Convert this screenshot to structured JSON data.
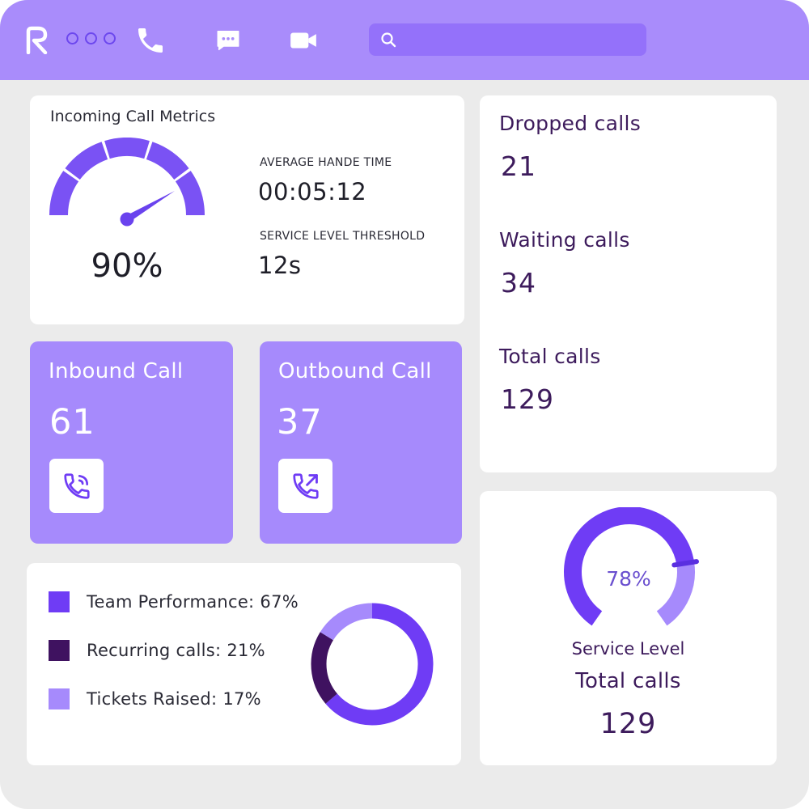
{
  "header": {
    "logo_letter": "R",
    "search_placeholder": "",
    "icons": [
      "logo-icon",
      "more-dots-icon",
      "phone-icon",
      "chat-icon",
      "video-icon",
      "search-icon"
    ]
  },
  "incoming_metrics": {
    "title": "Incoming Call Metrics",
    "gauge_value": "90%",
    "gauge_level": 0.9,
    "avg_handle_label": "AVERAGE HANDE TIME",
    "avg_handle_value": "00:05:12",
    "sla_threshold_label": "SERVICE LEVEL THRESHOLD",
    "sla_threshold_value": "12s"
  },
  "call_totals": {
    "dropped_label": "Dropped calls",
    "dropped_value": "21",
    "waiting_label": "Waiting calls",
    "waiting_value": "34",
    "total_label": "Total calls",
    "total_value": "129"
  },
  "inbound": {
    "title": "Inbound Call",
    "value": "61",
    "icon": "incoming-call-icon"
  },
  "outbound": {
    "title": "Outbound Call",
    "value": "37",
    "icon": "outgoing-call-icon"
  },
  "breakdown": {
    "items": [
      {
        "label": "Team Performance: 67%",
        "color": "#6f3cf5",
        "percent": 67
      },
      {
        "label": "Recurring calls: 21%",
        "color": "#3f1260",
        "percent": 21
      },
      {
        "label": "Tickets Raised: 17%",
        "color": "#a68afc",
        "percent": 17
      }
    ]
  },
  "service_level": {
    "percent_text": "78%",
    "level": 0.78,
    "label": "Service Level",
    "total_label": "Total calls",
    "total_value": "129"
  },
  "colors": {
    "accent": "#6f3cf5",
    "header": "#a98cfb",
    "card_purple": "#a68afc",
    "dark_purple": "#3f1260",
    "background": "#ebebeb"
  }
}
